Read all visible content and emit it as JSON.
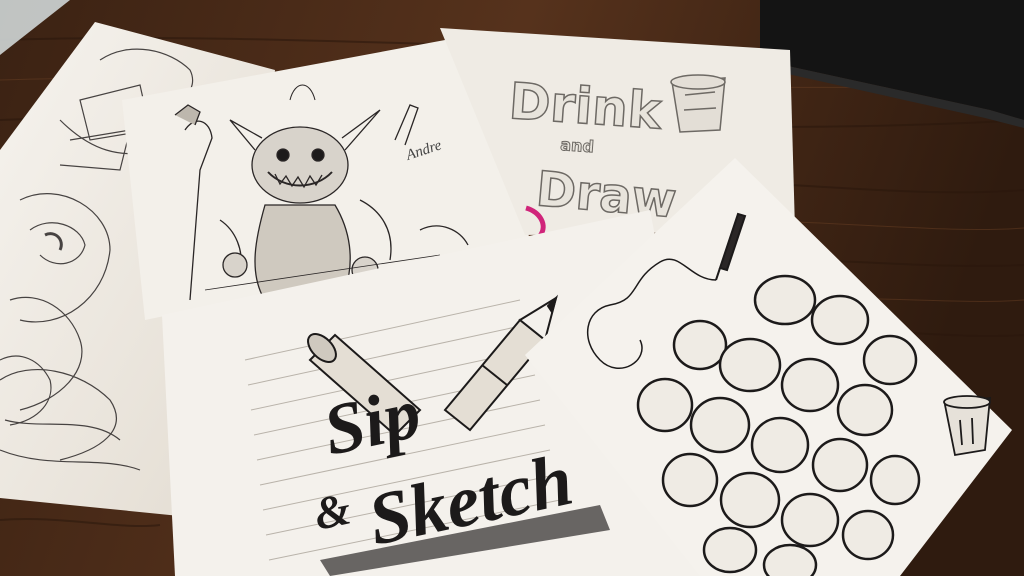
{
  "photo": {
    "subject": "hand-drawn sketches on sheets of paper spread across a wooden table",
    "colors": {
      "table": "#4a2c1a",
      "table_dark": "#2e1a0f",
      "paper": "#f1ede6",
      "paper_shadow": "#d9d2c6",
      "ink": "#1c1a1a",
      "pencil": "#7a7670",
      "tablet": "#141414",
      "pink_mark": "#d0247a"
    },
    "texts": {
      "drink": "Drink",
      "and": "and",
      "draw": "Draw",
      "sip": "Sip",
      "amp": "&",
      "sketch": "Sketch",
      "signature": "Andre"
    },
    "icons": [
      "glass-doodle-icon",
      "pencil-drawing-icon",
      "pen-drawing-icon",
      "cup-doodle-icon"
    ]
  }
}
